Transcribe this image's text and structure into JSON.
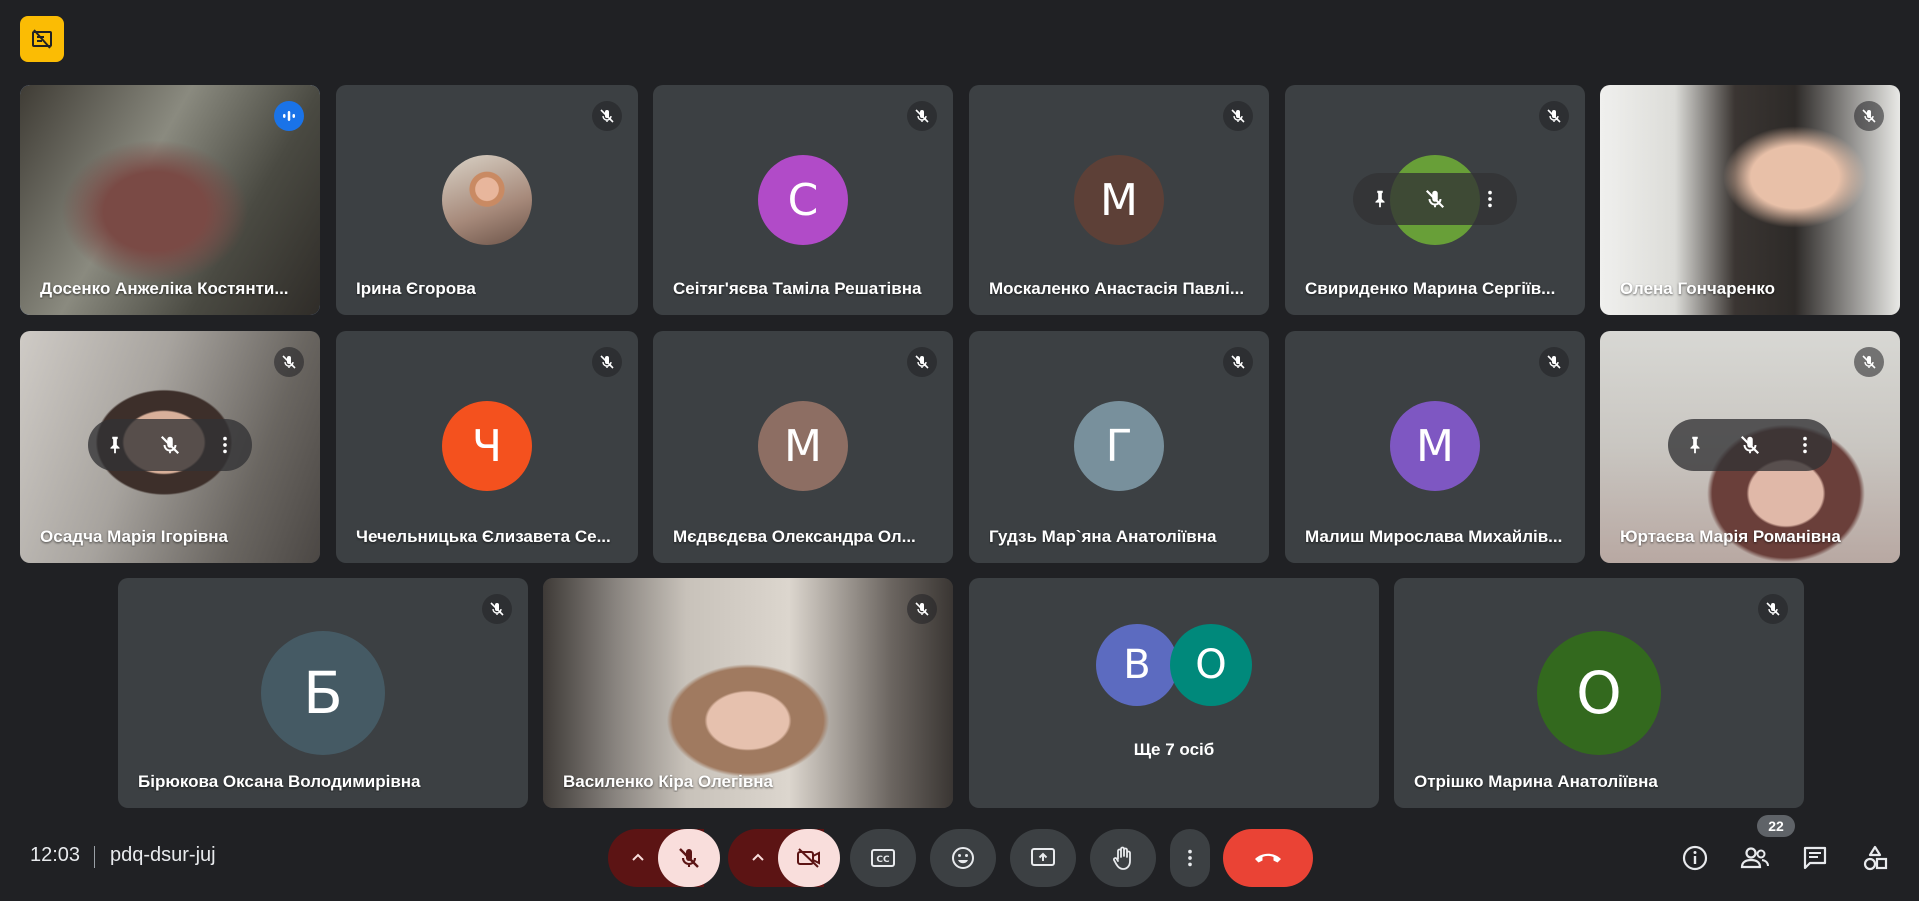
{
  "colors": {
    "background": "#202124",
    "tile": "#3c4043",
    "speaking_border": "#8ab4f8",
    "alert": "#fbbc04",
    "end_call": "#ea4335",
    "muted_bg": "#f9dedc",
    "muted_dark": "#5c1414"
  },
  "tiles": [
    {
      "name": "Досенко Анжеліка Костянти..."
    },
    {
      "name": "Ірина Єгорова"
    },
    {
      "name": "Сеітяг'яєва Таміла Решатівна",
      "initial": "С"
    },
    {
      "name": "Москаленко Анастасія Павлі...",
      "initial": "М"
    },
    {
      "name": "Свириденко Марина Сергіїв..."
    },
    {
      "name": "Олена Гончаренко"
    },
    {
      "name": "Осадча Марія Ігорівна"
    },
    {
      "name": "Чечельницька Єлизавета Се...",
      "initial": "Ч"
    },
    {
      "name": "Мєдвєдєва Олександра Ол...",
      "initial": "М"
    },
    {
      "name": "Гудзь Мар`яна Анатоліївна",
      "initial": "Г"
    },
    {
      "name": "Малиш Мирослава Михайлів...",
      "initial": "М"
    },
    {
      "name": "Юртаєва Марія Романівна"
    },
    {
      "name": "Бірюкова Оксана Володимирівна",
      "initial": "Б"
    },
    {
      "name": "Василенко Кіра Олегівна"
    },
    {
      "name": "Отрішко Марина Анатоліївна",
      "initial": "О"
    }
  ],
  "others": {
    "label": "Ще 7 осіб",
    "initials": [
      "В",
      "О"
    ]
  },
  "bottom": {
    "time": "12:03",
    "meeting_code": "pdq-dsur-juj",
    "participants_count": "22"
  },
  "icons": {
    "top_badge": "no-signal-icon",
    "mic_off": "mic-off-icon",
    "speaking": "audio-level-icon",
    "pin": "pin-icon",
    "more": "more-vert-icon",
    "captions": "closed-captions-icon",
    "emoji": "emoji-icon",
    "present": "present-screen-icon",
    "hand": "raise-hand-icon",
    "end": "call-end-icon",
    "info": "info-icon",
    "people": "people-icon",
    "chat": "chat-icon",
    "activities": "activities-icon"
  }
}
